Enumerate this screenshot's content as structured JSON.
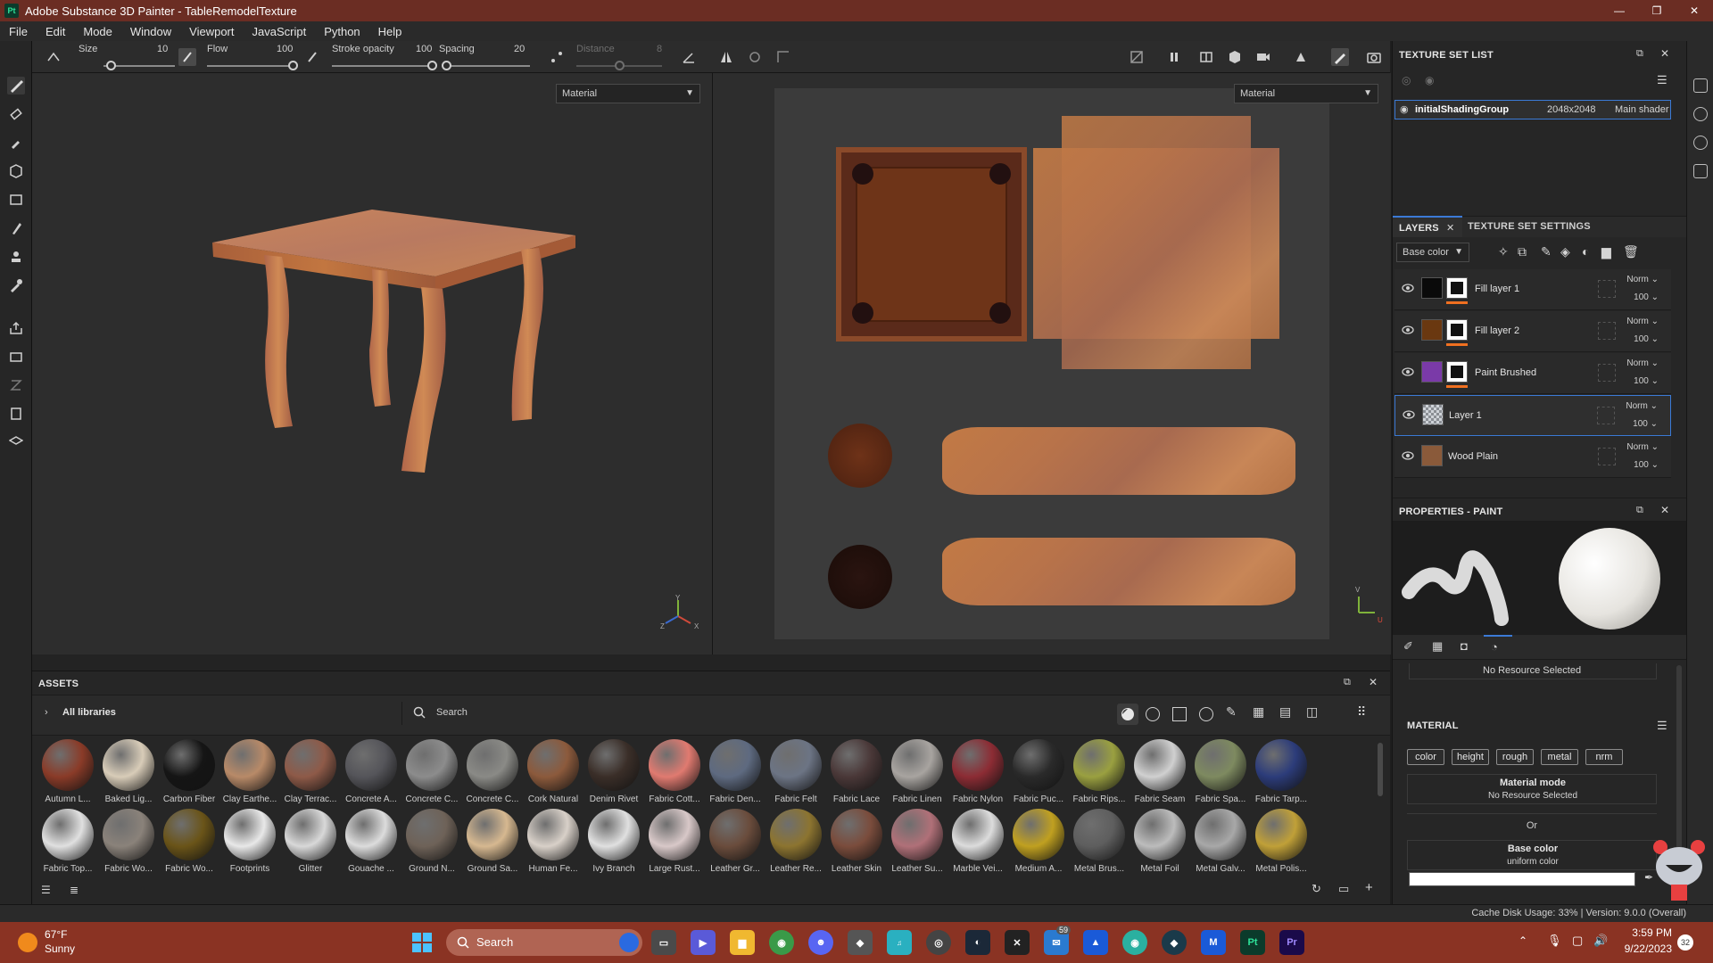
{
  "window": {
    "title": "Adobe Substance 3D Painter - TableRemodelTexture",
    "logo": "Pt",
    "minimize": "—",
    "maximize": "❐",
    "close": "✕"
  },
  "menu": [
    "File",
    "Edit",
    "Mode",
    "Window",
    "Viewport",
    "JavaScript",
    "Python",
    "Help"
  ],
  "context_bar": {
    "size_label": "Size",
    "size_value": "10",
    "flow_label": "Flow",
    "flow_value": "100",
    "stroke_opacity_label": "Stroke opacity",
    "stroke_opacity_value": "100",
    "spacing_label": "Spacing",
    "spacing_value": "20",
    "distance_label": "Distance",
    "distance_value": "8",
    "size_level": 0.1,
    "flow_level": 1.0,
    "stroke_opacity_level": 1.0,
    "spacing_level": 0.02,
    "distance_level": 0.5
  },
  "viewport": {
    "left_mode": "Material",
    "right_mode": "Material",
    "axis_y": "Y",
    "axis_x": "X",
    "axis_z": "Z",
    "axis_u": "U",
    "axis_v": "V"
  },
  "assets": {
    "title": "ASSETS",
    "library": "All libraries",
    "search_placeholder": "Search",
    "row1": [
      "Autumn L...",
      "Baked Lig...",
      "Carbon Fiber",
      "Clay Earthe...",
      "Clay Terrac...",
      "Concrete A...",
      "Concrete C...",
      "Concrete C...",
      "Cork Natural",
      "Denim Rivet",
      "Fabric Cott...",
      "Fabric Den...",
      "Fabric Felt",
      "Fabric Lace",
      "Fabric Linen",
      "Fabric Nylon",
      "Fabric Puc...",
      "Fabric Rips...",
      "Fabric Seam",
      "Fabric Spa...",
      "Fabric Tarp..."
    ],
    "row2": [
      "Fabric Top...",
      "Fabric Wo...",
      "Fabric Wo...",
      "Footprints",
      "Glitter",
      "Gouache ...",
      "Ground N...",
      "Ground Sa...",
      "Human Fe...",
      "Ivy Branch",
      "Large Rust...",
      "Leather Gr...",
      "Leather Re...",
      "Leather Skin",
      "Leather Su...",
      "Marble Vei...",
      "Medium A...",
      "Metal Brus...",
      "Metal Foil",
      "Metal Galv...",
      "Metal Polis..."
    ],
    "row1_colors": [
      "#8a3b28",
      "#d8ccb8",
      "#151515",
      "#b88a68",
      "#8e5a48",
      "#55555a",
      "#8c8c8c",
      "#8a8a86",
      "#8c5a3c",
      "#3a2e28",
      "#e07a70",
      "#5e6a80",
      "#6c7484",
      "#4a3838",
      "#a8a4a0",
      "#8c2c34",
      "#2a2a2a",
      "#9aa040",
      "#d0d0d0",
      "#7e8a60",
      "#2c3c7a"
    ],
    "row2_colors": [
      "#e0e0e0",
      "#8a827a",
      "#6a5418",
      "#e8e8e8",
      "#d8d8d8",
      "#dcdcdc",
      "#6e6258",
      "#d6b890",
      "#d8d0c8",
      "#e0e0e0",
      "#d8c8c8",
      "#6a4c3c",
      "#8c7430",
      "#7a4c3c",
      "#b07078",
      "#dcdcdc",
      "#c0a020",
      "#5e5e5e",
      "#bcbcbc",
      "#a8a8a8",
      "#c0a038"
    ]
  },
  "texture_set_list": {
    "title": "TEXTURE SET LIST",
    "item_name": "initialShadingGroup",
    "item_res": "2048x2048",
    "item_shader": "Main shader"
  },
  "layers": {
    "tab_layers": "LAYERS",
    "tab_settings": "TEXTURE SET SETTINGS",
    "channel": "Base color",
    "items": [
      {
        "name": "Fill layer 1",
        "blend": "Norm",
        "opacity": "100",
        "color": "#0a0a0a"
      },
      {
        "name": "Fill layer 2",
        "blend": "Norm",
        "opacity": "100",
        "color": "#6a3810"
      },
      {
        "name": "Paint Brushed",
        "blend": "Norm",
        "opacity": "100",
        "color": "#7a3aa8"
      },
      {
        "name": "Layer 1",
        "blend": "Norm",
        "opacity": "100",
        "color": "#cfd3d8"
      },
      {
        "name": "Wood Plain",
        "blend": "Norm",
        "opacity": "100",
        "color": "#8a5a3a"
      }
    ]
  },
  "properties": {
    "title": "PROPERTIES - PAINT",
    "prev_resource": "No Resource Selected",
    "material_header": "MATERIAL",
    "chips": [
      "color",
      "height",
      "rough",
      "metal",
      "nrm"
    ],
    "material_mode_label": "Material mode",
    "material_mode_value": "No Resource Selected",
    "or_label": "Or",
    "base_color_label": "Base color",
    "base_color_value": "uniform color",
    "base_color_hex": "#ffffff"
  },
  "status": {
    "cache": "Cache Disk Usage:   33% | Version: 9.0.0 (Overall)"
  },
  "taskbar": {
    "temp": "67°F",
    "weather": "Sunny",
    "search": "Search",
    "time": "3:59 PM",
    "date": "9/22/2023",
    "badge": "59",
    "notif": "32"
  }
}
